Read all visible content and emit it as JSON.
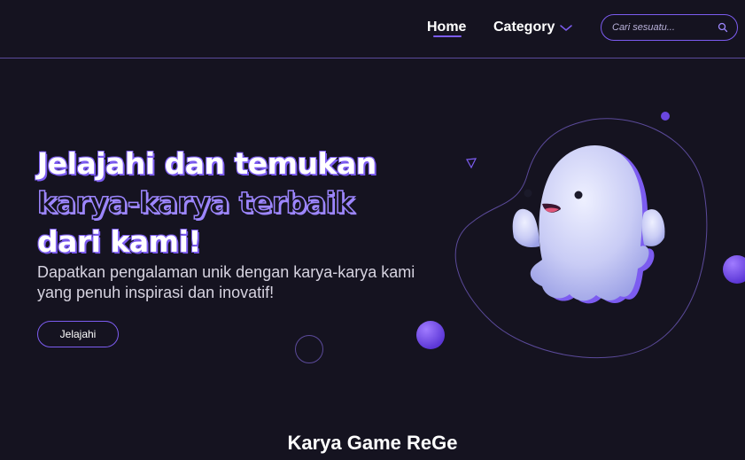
{
  "header": {
    "nav": {
      "home_label": "Home",
      "category_label": "Category"
    },
    "search": {
      "placeholder": "Cari sesuatu..."
    },
    "icons": {
      "search": "search-icon",
      "chevron": "chevron-down-icon"
    }
  },
  "hero": {
    "title_line_1": "Jelajahi dan temukan",
    "title_line_2": "karya-karya terbaik",
    "title_line_3": "dari kami!",
    "subtitle": "Dapatkan pengalaman unik dengan karya-karya kami yang penuh inspirasi dan inovatif!",
    "button_label": "Jelajahi",
    "illustration": "ghost-illustration"
  },
  "section": {
    "title": "Karya Game ReGe"
  },
  "colors": {
    "background": "#151320",
    "accent": "#7c5cf0",
    "accent_light": "#9d86ff",
    "text": "#ffffff",
    "muted_text": "#d6d3e0"
  }
}
